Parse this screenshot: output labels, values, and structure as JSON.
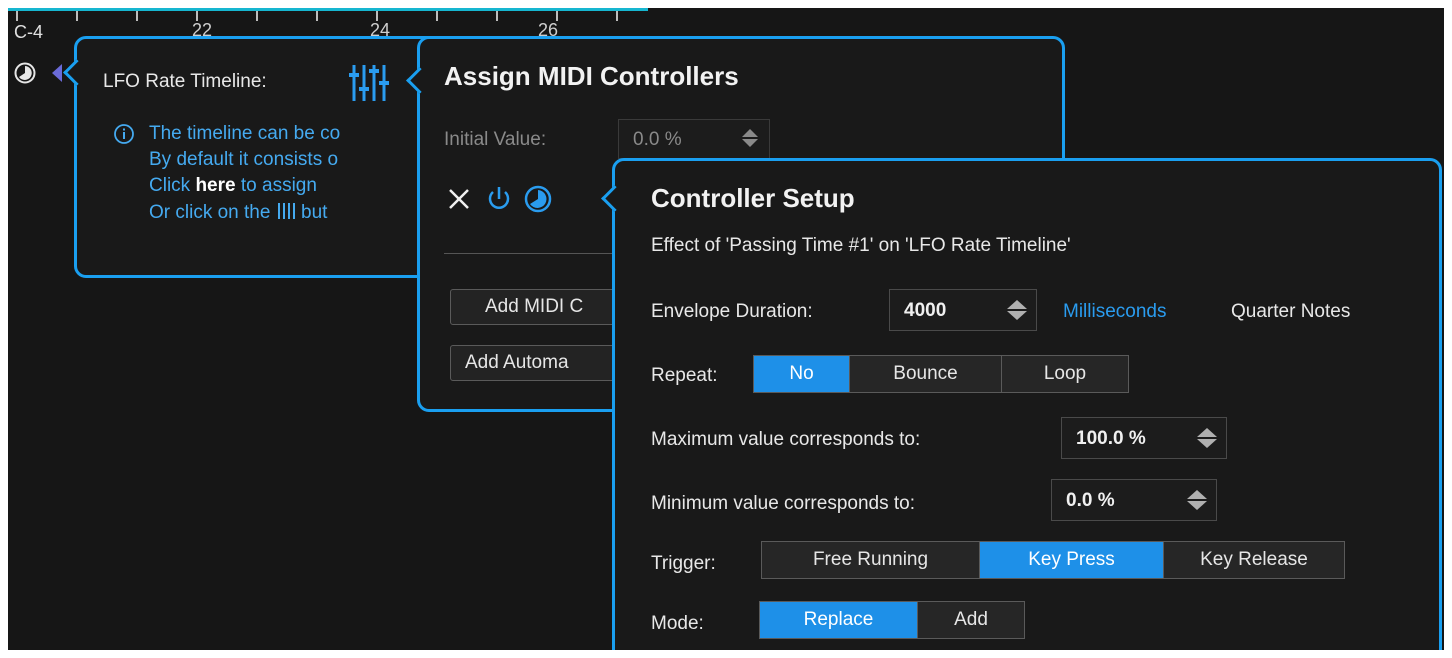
{
  "ruler": {
    "note": "C-4",
    "numbers": [
      "22",
      "24",
      "26"
    ]
  },
  "colors": {
    "accent": "#1a9ff0",
    "selected": "#1e90e8",
    "ruler_line": "#16b6d0"
  },
  "lfo_popup": {
    "title": "LFO Rate Timeline:",
    "lines": [
      "The timeline can be co",
      "By default it consists o",
      "Click",
      "here",
      "to assign",
      "Or click on the",
      "but"
    ],
    "icons": [
      "info-icon",
      "sliders-icon"
    ]
  },
  "assign_popup": {
    "title": "Assign MIDI Controllers",
    "initial_value_label": "Initial Value:",
    "initial_value": "0.0 %",
    "add_midi_button": "Add MIDI C",
    "add_automation_button": "Add Automa",
    "icons": [
      "close-icon",
      "power-icon",
      "clock-icon"
    ]
  },
  "controller_popup": {
    "title": "Controller Setup",
    "subtitle": "Effect of 'Passing Time #1' on 'LFO Rate Timeline'",
    "envelope_label": "Envelope Duration:",
    "envelope_value": "4000",
    "units": [
      "Milliseconds",
      "Quarter Notes"
    ],
    "units_selected": "Milliseconds",
    "repeat_label": "Repeat:",
    "repeat_options": [
      "No",
      "Bounce",
      "Loop"
    ],
    "repeat_selected": "No",
    "max_label": "Maximum value corresponds to:",
    "max_value": "100.0 %",
    "min_label": "Minimum value corresponds to:",
    "min_value": "0.0 %",
    "trigger_label": "Trigger:",
    "trigger_options": [
      "Free Running",
      "Key Press",
      "Key Release"
    ],
    "trigger_selected": "Key Press",
    "mode_label": "Mode:",
    "mode_options": [
      "Replace",
      "Add"
    ],
    "mode_selected": "Replace"
  }
}
